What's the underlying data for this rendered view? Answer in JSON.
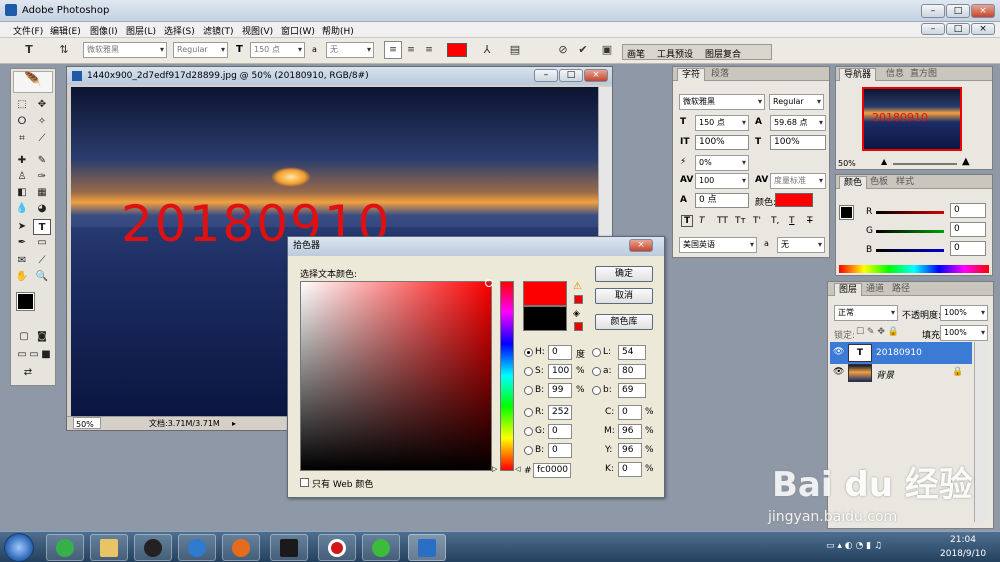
{
  "app": {
    "title": "Adobe Photoshop"
  },
  "menu": [
    "文件(F)",
    "编辑(E)",
    "图像(I)",
    "图层(L)",
    "选择(S)",
    "滤镜(T)",
    "视图(V)",
    "窗口(W)",
    "帮助(H)"
  ],
  "options": {
    "font_family": "微软雅黑",
    "font_style": "Regular",
    "font_size": "150 点",
    "aa_label": "a",
    "aa_value": "无",
    "text_color": "#fc0000",
    "panel_tabs": [
      "画笔",
      "工具预设",
      "图层复合"
    ]
  },
  "document": {
    "title": "1440x900_2d7edf917d28899.jpg @ 50% (20180910, RGB/8#)",
    "canvas_text": "20180910",
    "zoom": "50%",
    "doc_info": "文档:3.71M/3.71M"
  },
  "picker": {
    "title": "拾色器",
    "prompt": "选择文本颜色:",
    "ok": "确定",
    "cancel": "取消",
    "library": "颜色库",
    "fields": {
      "H": "0",
      "S": "100",
      "Bv": "99",
      "R": "252",
      "G": "0",
      "B": "0",
      "L": "54",
      "a": "80",
      "b": "69",
      "C": "0",
      "M": "96",
      "Y": "96",
      "K": "0",
      "hex": "fc0000"
    },
    "units": {
      "deg": "度",
      "pct": "%"
    },
    "web_only": "只有 Web 颜色",
    "new_color": "#fc0000",
    "current_color": "#000000"
  },
  "char_panel": {
    "tabs": [
      "字符",
      "段落"
    ],
    "font": "微软雅黑",
    "style": "Regular",
    "size": "150 点",
    "leading": "59.68 点",
    "vscale": "100%",
    "hscale": "100%",
    "baseline_pct": "0%",
    "kerning": "100",
    "tracking": "度量标准",
    "shift": "0 点",
    "color_label": "颜色:",
    "type_buttons": [
      "T",
      "T",
      "TT",
      "Tт",
      "T'",
      "T,",
      "T",
      "T"
    ],
    "language": "美国英语",
    "aa_label": "a",
    "aa": "无"
  },
  "nav_panel": {
    "tabs": [
      "导航器",
      "信息",
      "直方图"
    ],
    "zoom": "50%",
    "thumb_text": "20180910"
  },
  "color_panel": {
    "tabs": [
      "颜色",
      "色板",
      "样式"
    ],
    "channels": [
      {
        "name": "R",
        "value": "0",
        "color": "#d40000"
      },
      {
        "name": "G",
        "value": "0",
        "color": "#00a000"
      },
      {
        "name": "B",
        "value": "0",
        "color": "#0000d0"
      }
    ]
  },
  "layers_panel": {
    "tabs": [
      "图层",
      "通道",
      "路径"
    ],
    "mode": "正常",
    "opacity_label": "不透明度:",
    "opacity": "100%",
    "lock_label": "锁定:",
    "fill_label": "填充:",
    "fill": "100%",
    "layers": [
      {
        "name": "20180910",
        "type": "text"
      },
      {
        "name": "背景",
        "type": "image"
      }
    ]
  },
  "taskbar": {
    "time": "21:04",
    "date": "2018/9/10"
  },
  "watermark": {
    "brand": "Bai du 经验",
    "url": "jingyan.baidu.com"
  }
}
